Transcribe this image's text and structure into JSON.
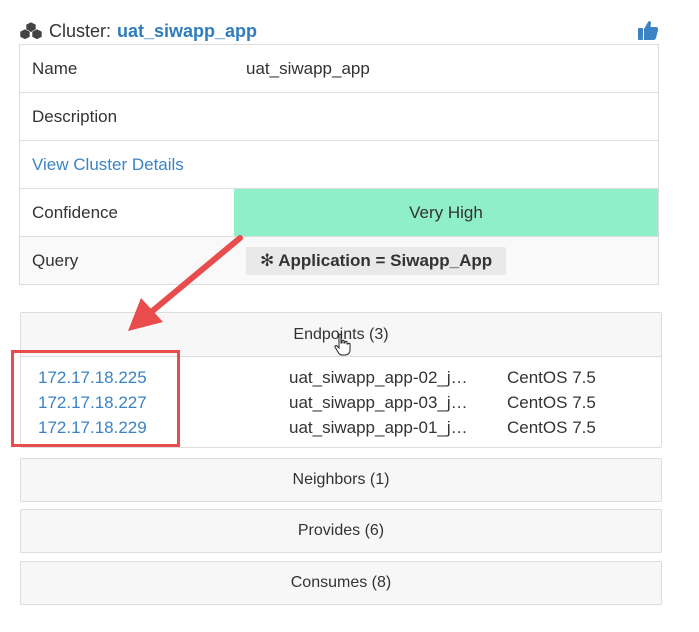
{
  "header": {
    "label": "Cluster:",
    "cluster_name": "uat_siwapp_app",
    "icon": "cluster-icon",
    "action_icon": "thumbs-up-icon"
  },
  "details": {
    "name_label": "Name",
    "name_value": "uat_siwapp_app",
    "description_label": "Description",
    "description_value": "",
    "view_details_link": "View Cluster Details",
    "confidence_label": "Confidence",
    "confidence_value": "Very High",
    "confidence_color": "#8fefc9",
    "query_label": "Query",
    "query_symbol": "✻",
    "query_value": "Application = Siwapp_App"
  },
  "endpoints": {
    "title": "Endpoints (3)",
    "rows": [
      {
        "ip": "172.17.18.225",
        "host": "uat_siwapp_app-02_j…",
        "os": "CentOS 7.5"
      },
      {
        "ip": "172.17.18.227",
        "host": "uat_siwapp_app-03_j…",
        "os": "CentOS 7.5"
      },
      {
        "ip": "172.17.18.229",
        "host": "uat_siwapp_app-01_j…",
        "os": "CentOS 7.5"
      }
    ]
  },
  "sections": {
    "neighbors": "Neighbors (1)",
    "provides": "Provides (6)",
    "consumes": "Consumes (8)"
  },
  "colors": {
    "link": "#3b83c4",
    "annotation": "#e84c4c"
  }
}
